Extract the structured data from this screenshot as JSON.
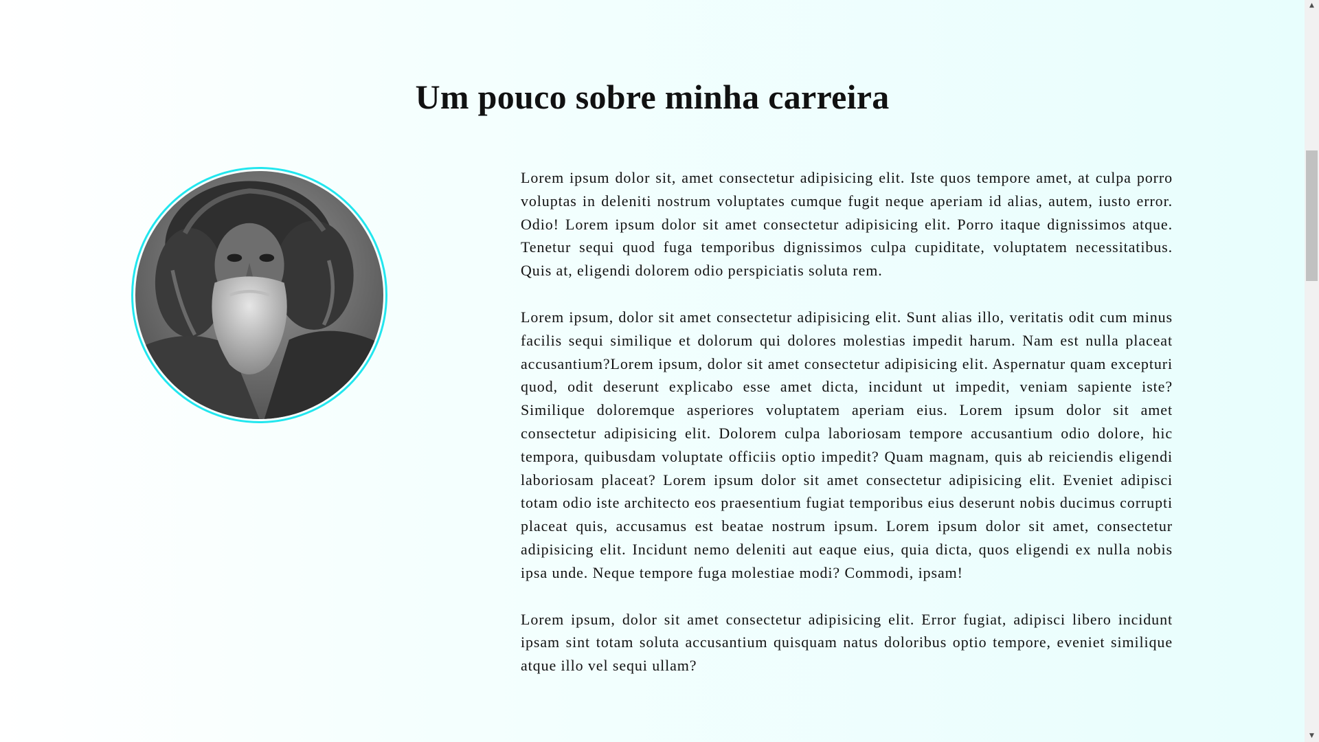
{
  "section": {
    "title": "Um pouco sobre minha carreira"
  },
  "profile": {
    "photo_alt": "Foto de perfil"
  },
  "paragraphs": [
    "Lorem ipsum dolor sit, amet consectetur adipisicing elit. Iste quos tempore amet, at culpa porro voluptas in deleniti nostrum voluptates cumque fugit neque aperiam id alias, autem, iusto error. Odio! Lorem ipsum dolor sit amet consectetur adipisicing elit. Porro itaque dignissimos atque. Tenetur sequi quod fuga temporibus dignissimos culpa cupiditate, voluptatem necessitatibus. Quis at, eligendi dolorem odio perspiciatis soluta rem.",
    "Lorem ipsum, dolor sit amet consectetur adipisicing elit. Sunt alias illo, veritatis odit cum minus facilis sequi similique et dolorum qui dolores molestias impedit harum. Nam est nulla placeat accusantium?Lorem ipsum, dolor sit amet consectetur adipisicing elit. Aspernatur quam excepturi quod, odit deserunt explicabo esse amet dicta, incidunt ut impedit, veniam sapiente iste? Similique doloremque asperiores voluptatem aperiam eius. Lorem ipsum dolor sit amet consectetur adipisicing elit. Dolorem culpa laboriosam tempore accusantium odio dolore, hic tempora, quibusdam voluptate officiis optio impedit? Quam magnam, quis ab reiciendis eligendi laboriosam placeat? Lorem ipsum dolor sit amet consectetur adipisicing elit. Eveniet adipisci totam odio iste architecto eos praesentium fugiat temporibus eius deserunt nobis ducimus corrupti placeat quis, accusamus est beatae nostrum ipsum. Lorem ipsum dolor sit amet, consectetur adipisicing elit. Incidunt nemo deleniti aut eaque eius, quia dicta, quos eligendi ex nulla nobis ipsa unde. Neque tempore fuga molestiae modi? Commodi, ipsam!",
    "Lorem ipsum, dolor sit amet consectetur adipisicing elit. Error fugiat, adipisci libero incidunt ipsam sint totam soluta accusantium quisquam natus doloribus optio tempore, eveniet similique atque illo vel sequi ullam?"
  ],
  "icons": {
    "scroll_up": "scroll-up-arrow-icon",
    "scroll_down": "scroll-down-arrow-icon"
  },
  "colors": {
    "avatar_border": "#22e6ee",
    "background_end": "#e8fefd",
    "text": "#111111"
  }
}
